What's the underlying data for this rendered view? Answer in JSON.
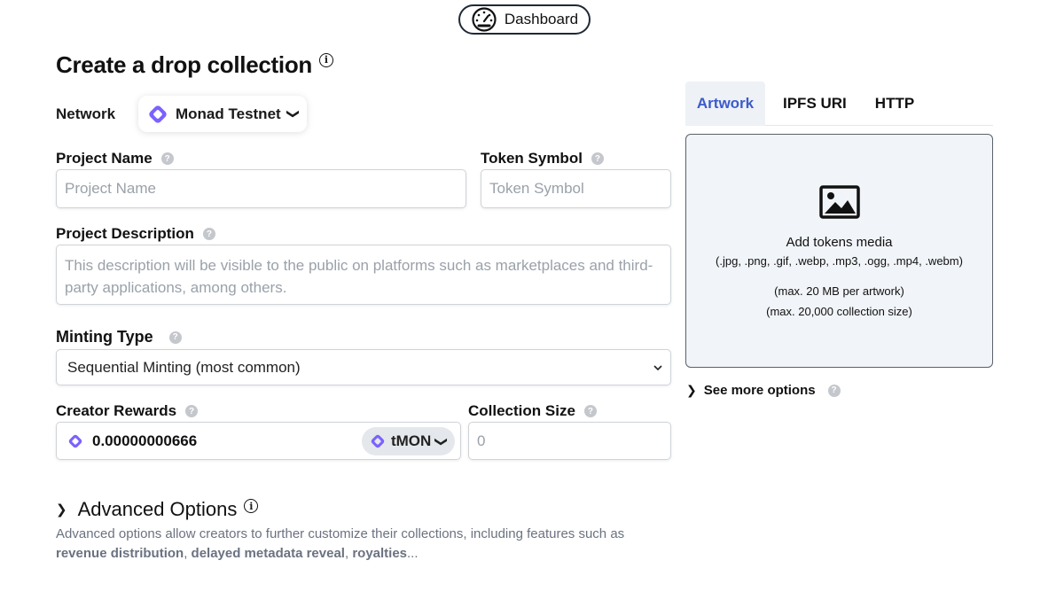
{
  "header": {
    "dashboard_label": "Dashboard",
    "dashboard_icon": "speedometer-icon"
  },
  "page": {
    "title": "Create a drop collection",
    "title_info_icon": "info-icon"
  },
  "network": {
    "label": "Network",
    "value": "Monad Testnet",
    "icon": "monad-logo-icon",
    "accent": "#7b61ff"
  },
  "project_name": {
    "label": "Project Name",
    "placeholder": "Project Name",
    "value": ""
  },
  "token_symbol": {
    "label": "Token Symbol",
    "placeholder": "Token Symbol",
    "value": ""
  },
  "project_description": {
    "label": "Project Description",
    "placeholder": "This description will be visible to the public on platforms such as marketplaces and third-party applications, among others.",
    "value": ""
  },
  "minting_type": {
    "label": "Minting Type",
    "selected": "Sequential Minting (most common)"
  },
  "creator_rewards": {
    "label": "Creator Rewards",
    "value": "0.00000000666",
    "token": "tMON"
  },
  "collection_size": {
    "label": "Collection Size",
    "placeholder": "0",
    "value": ""
  },
  "advanced": {
    "title": "Advanced Options",
    "desc_prefix": "Advanced options allow creators to further customize their collections, including features such as",
    "feature_1": "revenue distribution",
    "sep_1": ",",
    "feature_2": "delayed metadata reveal",
    "sep_2": ",",
    "feature_3": "royalties",
    "ellipsis": "..."
  },
  "media": {
    "tabs": [
      {
        "label": "Artwork",
        "active": true
      },
      {
        "label": "IPFS URI",
        "active": false
      },
      {
        "label": "HTTP",
        "active": false
      }
    ],
    "dropzone": {
      "title": "Add tokens media",
      "formats": "(.jpg, .png, .gif, .webp, .mp3, .ogg, .mp4, .webm)",
      "max_artwork": "(max. 20 MB per artwork)",
      "max_collection": "(max. 20,000 collection size)",
      "icon": "image-icon"
    },
    "see_more": "See more options"
  },
  "colors": {
    "active_tab_text": "#3b5bcc",
    "active_tab_bg": "#eef1f5",
    "dropzone_bg": "#f1f4f8",
    "monad_purple": "#7b61ff"
  }
}
